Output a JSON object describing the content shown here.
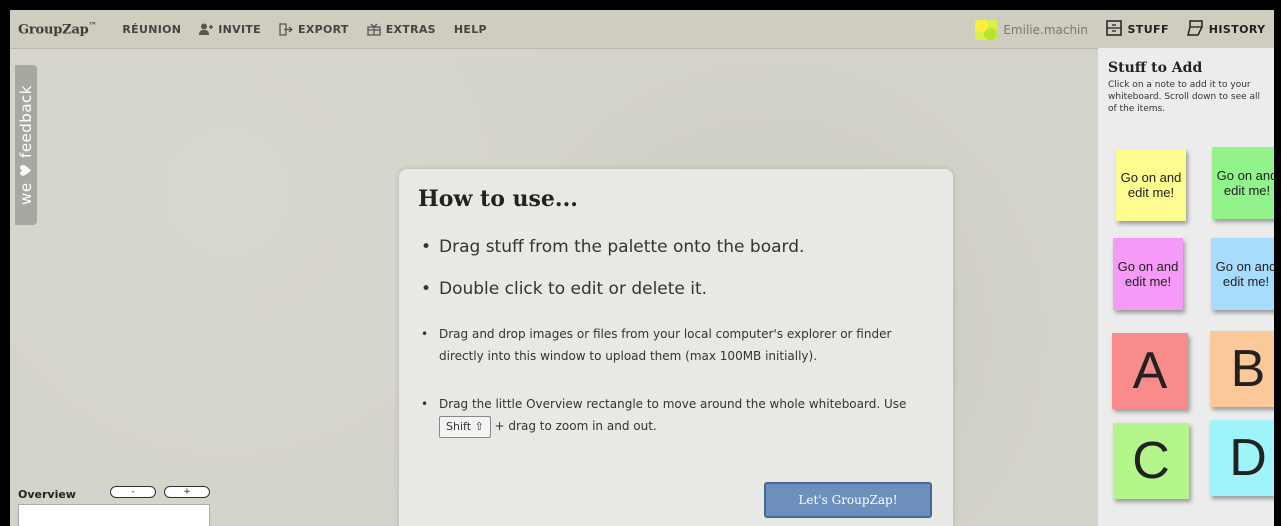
{
  "app": {
    "logo": "GroupZap",
    "logo_mark": "™"
  },
  "nav": [
    {
      "label": "RÉUNION",
      "icon": ""
    },
    {
      "label": "INVITE",
      "icon": "add-user-icon"
    },
    {
      "label": "EXPORT",
      "icon": "export-icon"
    },
    {
      "label": "EXTRAS",
      "icon": "extras-icon"
    },
    {
      "label": "HELP",
      "icon": ""
    }
  ],
  "user": {
    "name": "Emilie.machin"
  },
  "panel_tabs": {
    "stuff": "STUFF",
    "history": "HISTORY"
  },
  "panel": {
    "title": "Stuff to Add",
    "description": "Click on a note to add it to your whiteboard. Scroll down to see all of the items.",
    "notes": [
      {
        "text": "Go on and edit me!",
        "color": "#fcfc8f"
      },
      {
        "text": "Go on and edit me!",
        "color": "#92f28c"
      },
      {
        "text": "Go on and edit me!",
        "color": "#f59af6"
      },
      {
        "text": "Go on and edit me!",
        "color": "#a7dcfc"
      },
      {
        "text": "A",
        "color": "#f98b8b"
      },
      {
        "text": "B",
        "color": "#fbc89a"
      },
      {
        "text": "C",
        "color": "#b4f58c"
      },
      {
        "text": "D",
        "color": "#9ef4f8"
      }
    ]
  },
  "feedback": {
    "label": "we ♥ feedback"
  },
  "modal": {
    "title": "How to use...",
    "items": [
      "Drag stuff from the palette onto the board.",
      "Double click to edit or delete it.",
      "Drag and drop images or files from your local computer's explorer or finder directly into this window to upload them (max 100MB initially).",
      "Drag the little Overview rectangle to move around the whole whiteboard.  Use",
      "+ drag to zoom in and out."
    ],
    "key_label": "Shift ⇧",
    "button": "Let's GroupZap!"
  },
  "overview": {
    "label": "Overview",
    "zoom_out": "-",
    "zoom_in": "+"
  }
}
